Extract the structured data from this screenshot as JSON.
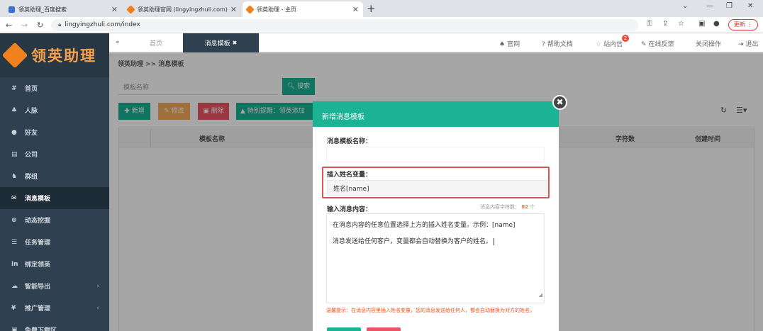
{
  "browser": {
    "tabs": [
      {
        "title": "领英助理_百度搜索",
        "favicon_color": "#3b6fd4"
      },
      {
        "title": "领英助理官网 (lingyingzhuli.com)",
        "favicon_color": "#f0821e"
      },
      {
        "title": "领英助理 - 主页",
        "favicon_color": "#f0821e"
      }
    ],
    "url": "lingyingzhuli.com/index",
    "update_label": "更新"
  },
  "app": {
    "logo_text": "领英助理",
    "sidebar": [
      {
        "label": "首页",
        "icon": "#"
      },
      {
        "label": "人脉",
        "icon": "♣"
      },
      {
        "label": "好友",
        "icon": "●"
      },
      {
        "label": "公司",
        "icon": "▤"
      },
      {
        "label": "群组",
        "icon": "♞"
      },
      {
        "label": "消息模板",
        "icon": "✉",
        "active": true
      },
      {
        "label": "动态挖掘",
        "icon": "⊕"
      },
      {
        "label": "任务管理",
        "icon": "☰"
      },
      {
        "label": "绑定领英",
        "icon": "in"
      },
      {
        "label": "智能导出",
        "icon": "☁",
        "arrow": "‹"
      },
      {
        "label": "推广管理",
        "icon": "¥",
        "arrow": "‹"
      },
      {
        "label": "免费下载区",
        "icon": "▣"
      }
    ],
    "topbar": {
      "back": "«",
      "tab_home": "首页",
      "tab_active": "消息模板",
      "tab_close": "✖",
      "links": [
        "官网",
        "帮助文档",
        "站内信",
        "在线反馈",
        "关闭操作",
        "退出"
      ],
      "link_icons": [
        "♠",
        "?",
        "♢",
        "✎",
        "",
        "⇥"
      ],
      "badge": "2"
    },
    "breadcrumb": "领英助理 >> 消息模板",
    "search": {
      "placeholder": "模板名称",
      "button": "搜索"
    },
    "actions": {
      "add": "新增",
      "edit": "修改",
      "delete": "删除",
      "notice": "特别提醒：领英添加"
    },
    "table": {
      "headers": [
        "模板名称",
        "字符数",
        "创建时间"
      ]
    },
    "colors": {
      "primary": "#1ab394",
      "edit": "#f8ac59",
      "delete": "#ed5565",
      "sidebar": "#2f4050"
    }
  },
  "modal": {
    "title": "新增消息模板",
    "close_icon": "✖",
    "name_label": "消息模板名称：",
    "var_label": "插入姓名变量：",
    "var_value": "姓名[name]",
    "content_label": "输入消息内容：",
    "counter_label": "消息内容字符数：",
    "counter_value": "82",
    "counter_unit": "个",
    "content_lines": [
      "在消息内容的任意位置选择上方的插入姓名变量。示例：[name]",
      "消息发送给任何客户，变量都会自动替换为客户的姓名。"
    ],
    "tip": "温馨提示：在消息内容里插入姓名变量，您的消息发送给任何人，都会自动替换为对方的姓名。"
  }
}
